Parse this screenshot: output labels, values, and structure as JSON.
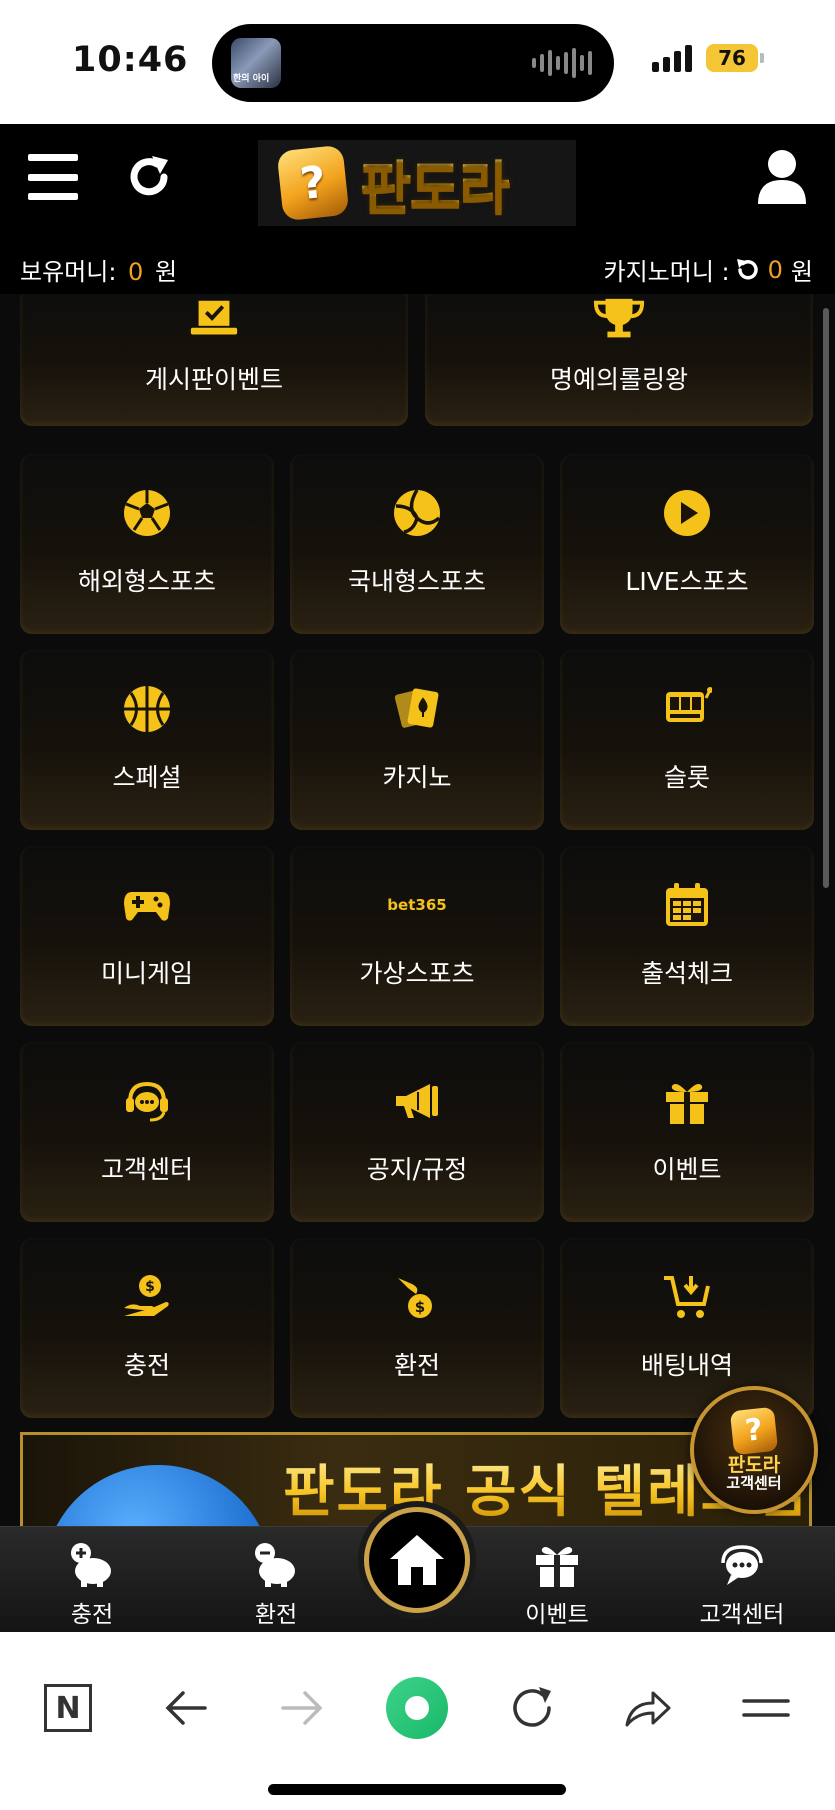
{
  "status_bar": {
    "time": "10:46",
    "island_thumb_text": "한의 아이",
    "battery": "76"
  },
  "header": {
    "logo_badge": "?",
    "logo_text": "판도라",
    "held_money_label": "보유머니:",
    "held_money_value": "0",
    "held_money_unit": "원",
    "casino_money_label": "카지노머니 :",
    "casino_money_value": "0",
    "casino_money_unit": "원"
  },
  "menu": {
    "top_row": [
      {
        "label": "게시판이벤트",
        "icon": "board-check-icon"
      },
      {
        "label": "명예의롤링왕",
        "icon": "trophy-icon"
      }
    ],
    "items": [
      {
        "label": "해외형스포츠",
        "icon": "soccer-ball-icon"
      },
      {
        "label": "국내형스포츠",
        "icon": "volleyball-icon"
      },
      {
        "label": "LIVE스포츠",
        "icon": "play-circle-icon"
      },
      {
        "label": "스페셜",
        "icon": "basketball-icon"
      },
      {
        "label": "카지노",
        "icon": "playing-cards-icon"
      },
      {
        "label": "슬롯",
        "icon": "slot-machine-icon"
      },
      {
        "label": "미니게임",
        "icon": "gamepad-icon"
      },
      {
        "label": "가상스포츠",
        "icon": "bet365-icon",
        "icon_text": "bet365"
      },
      {
        "label": "출석체크",
        "icon": "calendar-icon"
      },
      {
        "label": "고객센터",
        "icon": "headset-icon"
      },
      {
        "label": "공지/규정",
        "icon": "megaphone-icon"
      },
      {
        "label": "이벤트",
        "icon": "gift-icon"
      },
      {
        "label": "충전",
        "icon": "hand-coin-icon"
      },
      {
        "label": "환전",
        "icon": "coin-out-icon"
      },
      {
        "label": "배팅내역",
        "icon": "cart-icon"
      }
    ]
  },
  "banner": {
    "text": "판도라 공식 텔레그램"
  },
  "floating_cs": {
    "badge": "?",
    "line1": "판도라",
    "line2": "고객센터"
  },
  "bottom_nav": {
    "items": [
      {
        "label": "충전",
        "icon": "piggy-plus-icon"
      },
      {
        "label": "환전",
        "icon": "piggy-minus-icon"
      },
      {
        "label": "",
        "icon": "home-icon"
      },
      {
        "label": "이벤트",
        "icon": "gift-icon"
      },
      {
        "label": "고객센터",
        "icon": "chat-bubble-icon"
      }
    ]
  },
  "browser": {
    "naver_label": "N"
  },
  "colors": {
    "accent_gold": "#f5c21a",
    "money_orange": "#f0a020",
    "app_background": "#0b0b0b"
  }
}
